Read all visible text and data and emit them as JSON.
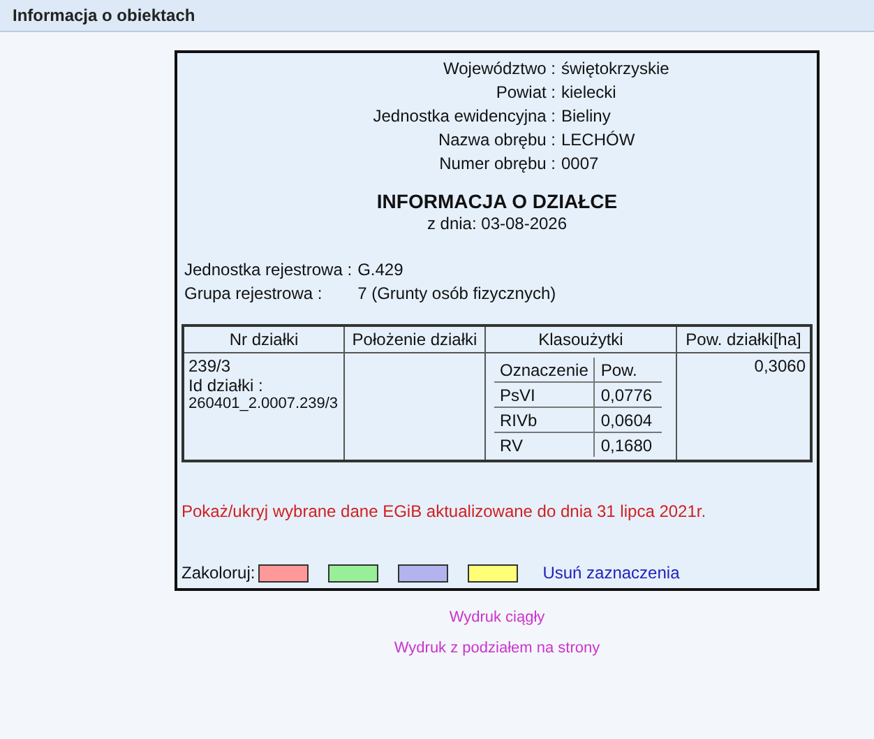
{
  "header": {
    "title": "Informacja o obiektach"
  },
  "location": [
    {
      "label": "Województwo :",
      "value": "świętokrzyskie"
    },
    {
      "label": "Powiat :",
      "value": "kielecki"
    },
    {
      "label": "Jednostka ewidencyjna :",
      "value": "Bieliny"
    },
    {
      "label": "Nazwa obrębu :",
      "value": "LECHÓW"
    },
    {
      "label": "Numer obrębu :",
      "value": "0007"
    }
  ],
  "title": "INFORMACJA O DZIAŁCE",
  "date": "z dnia: 03-08-2026",
  "registry": [
    {
      "label": "Jednostka rejestrowa :",
      "value": "G.429"
    },
    {
      "label": "Grupa rejestrowa :",
      "value": "7 (Grunty osób fizycznych)"
    }
  ],
  "table": {
    "columns": [
      "Nr działki",
      "Położenie działki",
      "Klasoużytki",
      "Pow. działki[ha]"
    ],
    "rows": [
      {
        "number": "239/3",
        "id_label": "Id działki :",
        "id": "260401_2.0007.239/3",
        "location": "",
        "classes": {
          "columns": [
            "Oznaczenie",
            "Pow."
          ],
          "rows": [
            [
              "PsVI",
              "0,0776"
            ],
            [
              "RIVb",
              "0,0604"
            ],
            [
              "RV",
              "0,1680"
            ]
          ]
        },
        "area": "0,3060"
      }
    ]
  },
  "toggle_link": "Pokaż/ukryj wybrane dane EGiB aktualizowane do dnia 31 lipca 2021r.",
  "colorize": {
    "label": "Zakoloruj:",
    "swatches": [
      {
        "color": "#ff9999"
      },
      {
        "color": "#99ee99"
      },
      {
        "color": "#b3b3ee"
      },
      {
        "color": "#ffff77"
      }
    ],
    "clear_link": "Usuń zaznaczenia"
  },
  "print_links": [
    "Wydruk ciągły",
    "Wydruk z podziałem na strony"
  ]
}
